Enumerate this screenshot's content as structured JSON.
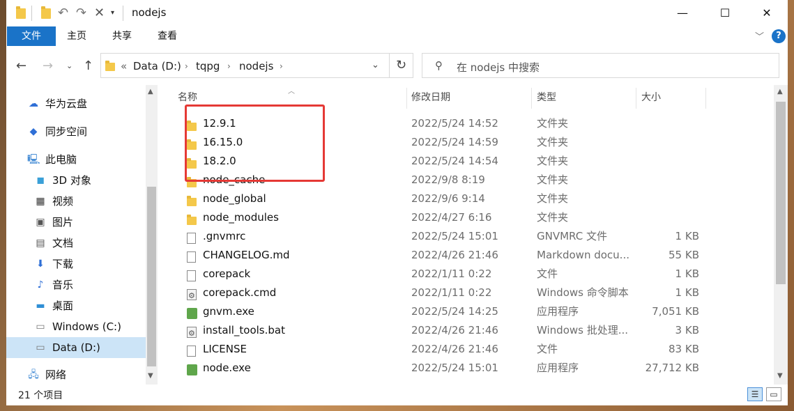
{
  "window": {
    "title": "nodejs"
  },
  "ribbon": {
    "tabs": [
      "文件",
      "主页",
      "共享",
      "查看"
    ]
  },
  "address": {
    "crumbs": [
      "Data (D:)",
      "tqpg",
      "nodejs"
    ],
    "overflow": "«"
  },
  "search": {
    "placeholder": "在 nodejs 中搜索"
  },
  "nav": {
    "items": [
      {
        "label": "华为云盘",
        "icon": "cloud-icon"
      },
      {
        "label": "同步空间",
        "icon": "sync-space-icon"
      },
      {
        "label": "此电脑",
        "icon": "computer-icon"
      },
      {
        "label": "3D 对象",
        "icon": "3d-objects-icon"
      },
      {
        "label": "视频",
        "icon": "video-icon"
      },
      {
        "label": "图片",
        "icon": "pictures-icon"
      },
      {
        "label": "文档",
        "icon": "documents-icon"
      },
      {
        "label": "下载",
        "icon": "download-icon"
      },
      {
        "label": "音乐",
        "icon": "music-icon"
      },
      {
        "label": "桌面",
        "icon": "desktop-icon"
      },
      {
        "label": "Windows (C:)",
        "icon": "drive-c-icon"
      },
      {
        "label": "Data (D:)",
        "icon": "drive-d-icon",
        "selected": true
      },
      {
        "label": "网络",
        "icon": "network-icon"
      }
    ]
  },
  "columns": {
    "name": "名称",
    "date": "修改日期",
    "type": "类型",
    "size": "大小"
  },
  "files": [
    {
      "name": "12.9.1",
      "date": "2022/5/24 14:52",
      "type": "文件夹",
      "size": "",
      "icon": "folder"
    },
    {
      "name": "16.15.0",
      "date": "2022/5/24 14:59",
      "type": "文件夹",
      "size": "",
      "icon": "folder"
    },
    {
      "name": "18.2.0",
      "date": "2022/5/24 14:54",
      "type": "文件夹",
      "size": "",
      "icon": "folder"
    },
    {
      "name": "node_cache",
      "date": "2022/9/8 8:19",
      "type": "文件夹",
      "size": "",
      "icon": "folder"
    },
    {
      "name": "node_global",
      "date": "2022/9/6 9:14",
      "type": "文件夹",
      "size": "",
      "icon": "folder"
    },
    {
      "name": "node_modules",
      "date": "2022/4/27 6:16",
      "type": "文件夹",
      "size": "",
      "icon": "folder"
    },
    {
      "name": ".gnvmrc",
      "date": "2022/5/24 15:01",
      "type": "GNVMRC 文件",
      "size": "1 KB",
      "icon": "doc"
    },
    {
      "name": "CHANGELOG.md",
      "date": "2022/4/26 21:46",
      "type": "Markdown docu...",
      "size": "55 KB",
      "icon": "doc"
    },
    {
      "name": "corepack",
      "date": "2022/1/11 0:22",
      "type": "文件",
      "size": "1 KB",
      "icon": "doc"
    },
    {
      "name": "corepack.cmd",
      "date": "2022/1/11 0:22",
      "type": "Windows 命令脚本",
      "size": "1 KB",
      "icon": "gear"
    },
    {
      "name": "gnvm.exe",
      "date": "2022/5/24 14:25",
      "type": "应用程序",
      "size": "7,051 KB",
      "icon": "exe"
    },
    {
      "name": "install_tools.bat",
      "date": "2022/4/26 21:46",
      "type": "Windows 批处理...",
      "size": "3 KB",
      "icon": "gear"
    },
    {
      "name": "LICENSE",
      "date": "2022/4/26 21:46",
      "type": "文件",
      "size": "83 KB",
      "icon": "doc"
    },
    {
      "name": "node.exe",
      "date": "2022/5/24 15:01",
      "type": "应用程序",
      "size": "27,712 KB",
      "icon": "exe"
    }
  ],
  "status": {
    "count": "21 个项目"
  },
  "colors": {
    "accent": "#1a73c8",
    "highlight": "#e53935",
    "selected": "#cce4f7"
  }
}
